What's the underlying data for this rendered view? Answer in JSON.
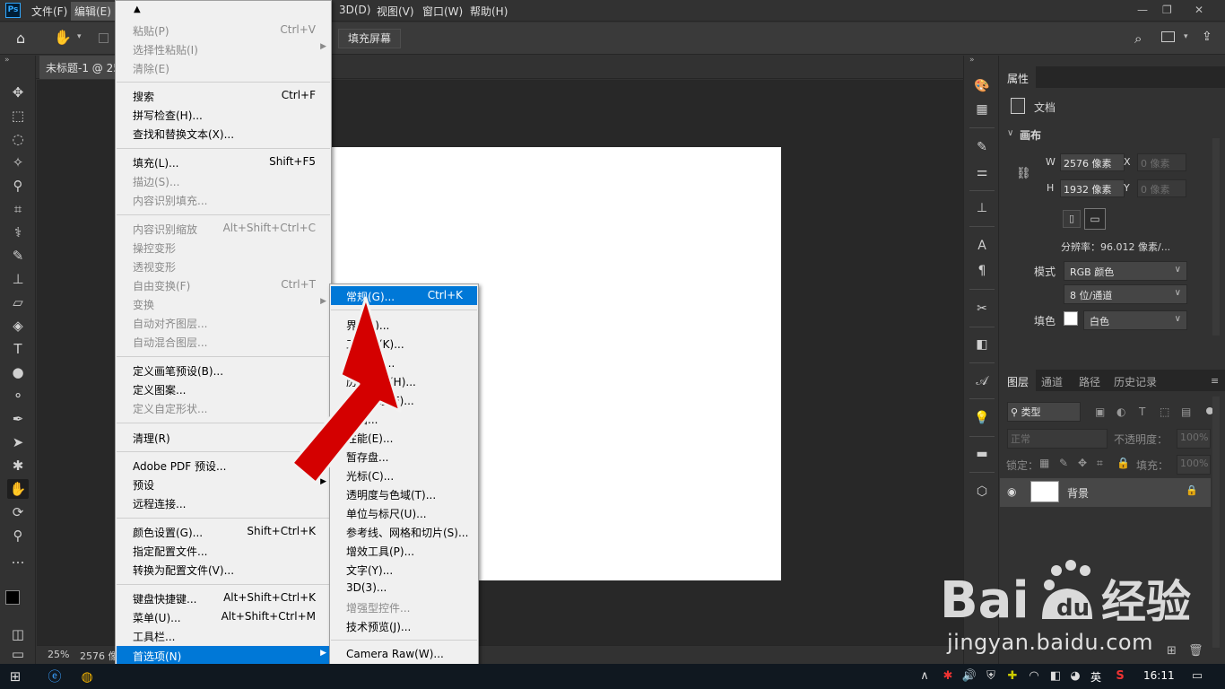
{
  "menubar": {
    "items": [
      "文件(F)",
      "编辑(E)",
      "3D(D)",
      "视图(V)",
      "窗口(W)",
      "帮助(H)"
    ],
    "logo": "Ps"
  },
  "options_bar": {
    "fill_screen_label": "填充屏幕"
  },
  "document": {
    "tab_title": "未标题-1 @ 25",
    "zoom": "25%",
    "size_status": "2576 像"
  },
  "edit_menu": {
    "items": [
      {
        "label": "粘贴(P)",
        "shortcut": "Ctrl+V",
        "disabled": true
      },
      {
        "label": "选择性粘贴(I)",
        "shortcut": "",
        "disabled": true,
        "submenu": true
      },
      {
        "label": "清除(E)",
        "shortcut": "",
        "disabled": true
      },
      {
        "label": "搜索",
        "shortcut": "Ctrl+F",
        "disabled": false
      },
      {
        "label": "拼写检查(H)...",
        "shortcut": "",
        "disabled": false
      },
      {
        "label": "查找和替换文本(X)...",
        "shortcut": "",
        "disabled": false
      },
      {
        "label": "填充(L)...",
        "shortcut": "Shift+F5",
        "disabled": false
      },
      {
        "label": "描边(S)...",
        "shortcut": "",
        "disabled": true
      },
      {
        "label": "内容识别填充...",
        "shortcut": "",
        "disabled": true
      },
      {
        "label": "内容识别缩放",
        "shortcut": "Alt+Shift+Ctrl+C",
        "disabled": true
      },
      {
        "label": "操控变形",
        "shortcut": "",
        "disabled": true
      },
      {
        "label": "透视变形",
        "shortcut": "",
        "disabled": true
      },
      {
        "label": "自由变换(F)",
        "shortcut": "Ctrl+T",
        "disabled": true
      },
      {
        "label": "变换",
        "shortcut": "",
        "disabled": true,
        "submenu": true
      },
      {
        "label": "自动对齐图层...",
        "shortcut": "",
        "disabled": true
      },
      {
        "label": "自动混合图层...",
        "shortcut": "",
        "disabled": true
      },
      {
        "label": "定义画笔预设(B)...",
        "shortcut": "",
        "disabled": false
      },
      {
        "label": "定义图案...",
        "shortcut": "",
        "disabled": false
      },
      {
        "label": "定义自定形状...",
        "shortcut": "",
        "disabled": true
      },
      {
        "label": "清理(R)",
        "shortcut": "",
        "disabled": false,
        "submenu": true
      },
      {
        "label": "Adobe PDF 预设...",
        "shortcut": "",
        "disabled": false
      },
      {
        "label": "预设",
        "shortcut": "",
        "disabled": false,
        "submenu": true
      },
      {
        "label": "远程连接...",
        "shortcut": "",
        "disabled": false
      },
      {
        "label": "颜色设置(G)...",
        "shortcut": "Shift+Ctrl+K",
        "disabled": false
      },
      {
        "label": "指定配置文件...",
        "shortcut": "",
        "disabled": false
      },
      {
        "label": "转换为配置文件(V)...",
        "shortcut": "",
        "disabled": false
      },
      {
        "label": "键盘快捷键...",
        "shortcut": "Alt+Shift+Ctrl+K",
        "disabled": false
      },
      {
        "label": "菜单(U)...",
        "shortcut": "Alt+Shift+Ctrl+M",
        "disabled": false
      },
      {
        "label": "工具栏...",
        "shortcut": "",
        "disabled": false
      },
      {
        "label": "首选项(N)",
        "shortcut": "",
        "disabled": false,
        "submenu": true,
        "highlighted": true
      }
    ]
  },
  "preferences_submenu": {
    "items": [
      {
        "label": "常规(G)...",
        "shortcut": "Ctrl+K",
        "highlighted": true
      },
      {
        "label": "界面(I)...",
        "shortcut": ""
      },
      {
        "label": "工作区(K)...",
        "shortcut": ""
      },
      {
        "label": "工具(O)...",
        "shortcut": ""
      },
      {
        "label": "历史记录(H)...",
        "shortcut": ""
      },
      {
        "label": "文件处理(F)...",
        "shortcut": ""
      },
      {
        "label": "导出...",
        "shortcut": ""
      },
      {
        "label": "性能(E)...",
        "shortcut": ""
      },
      {
        "label": "暂存盘...",
        "shortcut": ""
      },
      {
        "label": "光标(C)...",
        "shortcut": ""
      },
      {
        "label": "透明度与色域(T)...",
        "shortcut": ""
      },
      {
        "label": "单位与标尺(U)...",
        "shortcut": ""
      },
      {
        "label": "参考线、网格和切片(S)...",
        "shortcut": ""
      },
      {
        "label": "增效工具(P)...",
        "shortcut": ""
      },
      {
        "label": "文字(Y)...",
        "shortcut": ""
      },
      {
        "label": "3D(3)...",
        "shortcut": ""
      },
      {
        "label": "增强型控件...",
        "shortcut": "",
        "disabled": true
      },
      {
        "label": "技术预览(J)...",
        "shortcut": ""
      },
      {
        "label": "Camera Raw(W)...",
        "shortcut": ""
      }
    ]
  },
  "properties": {
    "tab": "属性",
    "doc_label": "文档",
    "canvas_section": "画布",
    "w_label": "W",
    "w_value": "2576 像素",
    "h_label": "H",
    "h_value": "1932 像素",
    "x_label": "X",
    "x_value": "0 像素",
    "y_label": "Y",
    "y_value": "0 像素",
    "resolution": "分辨率：96.012 像素/...",
    "mode_label": "模式",
    "mode_value": "RGB 颜色",
    "depth_value": "8 位/通道",
    "fill_label": "填色",
    "fill_value": "白色"
  },
  "layers": {
    "tabs": [
      "图层",
      "通道",
      "路径",
      "历史记录"
    ],
    "filter_placeholder": "类型",
    "blend_mode": "正常",
    "opacity_label": "不透明度：",
    "opacity_value": "100%",
    "lock_label": "锁定：",
    "fill_label": "填充：",
    "fill_value": "100%",
    "layer_name": "背景"
  },
  "watermark": {
    "site": "jingyan.baidu.com"
  },
  "taskbar": {
    "ime": "英",
    "time": "16:11"
  },
  "colors": {
    "accent": "#0078d7",
    "arrow": "#d40000"
  }
}
